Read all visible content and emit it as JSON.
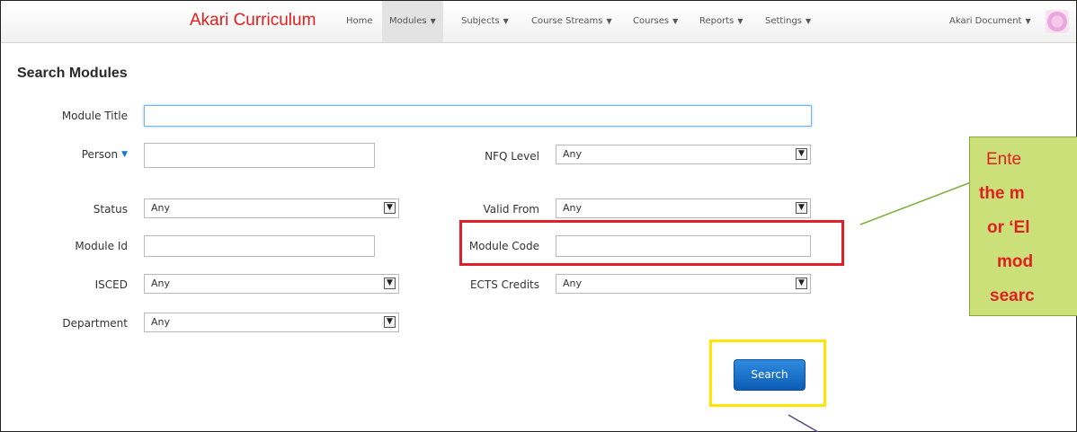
{
  "nav": {
    "brand": "Akari Curriculum",
    "items": [
      {
        "label": "Home",
        "caret": ""
      },
      {
        "label": "Modules",
        "caret": "▼"
      },
      {
        "label": "Subjects",
        "caret": "▼"
      },
      {
        "label": "Course Streams",
        "caret": "▼"
      },
      {
        "label": "Courses",
        "caret": "▼"
      },
      {
        "label": "Reports",
        "caret": "▼"
      },
      {
        "label": "Settings",
        "caret": "▼"
      }
    ],
    "user": "Akari Document",
    "user_caret": "▼"
  },
  "page": {
    "title": "Search Modules"
  },
  "form": {
    "module_title": {
      "label": "Module Title",
      "value": ""
    },
    "person": {
      "label": "Person",
      "caret": "▼",
      "value": ""
    },
    "nfq_level": {
      "label": "NFQ Level",
      "value": "Any"
    },
    "status": {
      "label": "Status",
      "value": "Any"
    },
    "valid_from": {
      "label": "Valid From",
      "value": "Any"
    },
    "module_id": {
      "label": "Module Id",
      "value": ""
    },
    "module_code": {
      "label": "Module Code",
      "value": ""
    },
    "isced": {
      "label": "ISCED",
      "value": "Any"
    },
    "ects_credits": {
      "label": "ECTS Credits",
      "value": "Any"
    },
    "department": {
      "label": "Department",
      "value": "Any"
    },
    "select_arrow": "▼"
  },
  "search_button": "Search",
  "callout": {
    "lines": [
      "Ente",
      "the m",
      "or ‘El",
      "mod",
      "searc"
    ]
  },
  "colors": {
    "brand": "#e0201c",
    "highlight_red": "#e01f26",
    "highlight_yellow": "#ffe500",
    "callout_bg": "#cce07a",
    "button": "#1a73d6"
  }
}
